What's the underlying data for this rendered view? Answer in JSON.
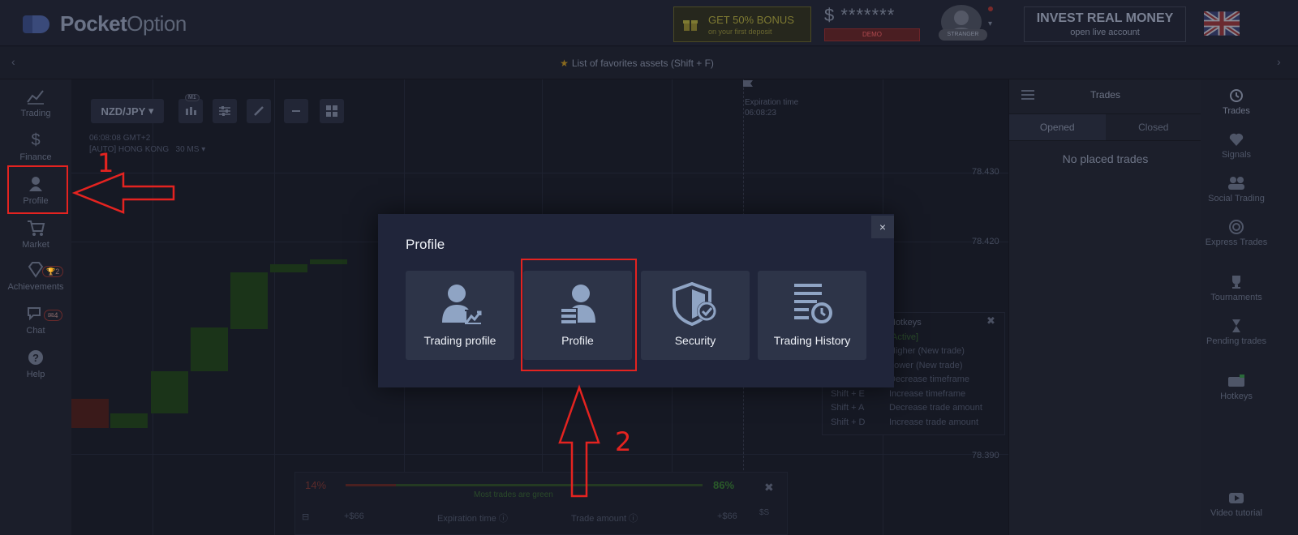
{
  "header": {
    "logo_bold": "Pocket",
    "logo_light": "Option",
    "bonus_title": "GET 50% BONUS",
    "bonus_sub": "on your first deposit",
    "balance": "$ *******",
    "account_type": "DEMO",
    "user_badge": "STRANGER",
    "invest_title": "INVEST REAL MONEY",
    "invest_sub": "open live account",
    "language_flag": "uk-flag-icon"
  },
  "favorites_bar": {
    "text": "List of favorites assets (Shift + F)"
  },
  "left_nav": {
    "items": [
      {
        "label": "Trading",
        "icon": "chart-line-icon"
      },
      {
        "label": "Finance",
        "icon": "dollar-icon"
      },
      {
        "label": "Profile",
        "icon": "user-icon"
      },
      {
        "label": "Market",
        "icon": "cart-icon"
      },
      {
        "label": "Achievements",
        "icon": "diamond-icon",
        "badge": "2"
      },
      {
        "label": "Chat",
        "icon": "chat-icon",
        "badge": "4"
      },
      {
        "label": "Help",
        "icon": "help-icon"
      }
    ]
  },
  "chart": {
    "pair": "NZD/JPY",
    "timeframe_badge": "M1",
    "time": "06:08:08 GMT+2",
    "session": "[AUTO] HONG KONG",
    "period": "30 MS",
    "expiration_label": "Expiration time",
    "expiration_time": "06:08:23",
    "price_ticks": [
      "78.430",
      "78.420",
      "78.390"
    ],
    "hotkeys_title": "Hotkeys",
    "hotkeys_status": "[Active]",
    "hotkeys": [
      {
        "key": "",
        "action": "Higher (New trade)"
      },
      {
        "key": "",
        "action": "Lower (New trade)"
      },
      {
        "key": "",
        "action": "Decrease timeframe"
      },
      {
        "key": "Shift + E",
        "action": "Increase timeframe"
      },
      {
        "key": "Shift + A",
        "action": "Decrease trade amount"
      },
      {
        "key": "Shift + D",
        "action": "Increase trade amount"
      }
    ],
    "sentiment_low": "14%",
    "sentiment_high": "86%",
    "sentiment_note": "Most trades are green",
    "sentiment_fraction": 0.86,
    "bottom_row": {
      "left_amount": "+$66",
      "expiration_label": "Expiration time",
      "trade_amount_label": "Trade amount",
      "right_amount": "+$66",
      "currency": "$S"
    }
  },
  "trades_panel": {
    "title": "Trades",
    "tabs": [
      "Opened",
      "Closed"
    ],
    "empty_text": "No placed trades"
  },
  "right_nav": {
    "items": [
      {
        "label": "Trades",
        "icon": "history-icon"
      },
      {
        "label": "Signals",
        "icon": "signal-icon"
      },
      {
        "label": "Social Trading",
        "icon": "people-icon"
      },
      {
        "label": "Express Trades",
        "icon": "target-icon"
      },
      {
        "label": "Tournaments",
        "icon": "trophy-icon"
      },
      {
        "label": "Pending trades",
        "icon": "hourglass-icon"
      },
      {
        "label": "Hotkeys",
        "icon": "keyboard-icon"
      },
      {
        "label": "Video tutorial",
        "icon": "video-icon"
      }
    ]
  },
  "modal": {
    "title": "Profile",
    "close": "×",
    "tiles": [
      {
        "label": "Trading profile",
        "icon": "trading-profile-icon"
      },
      {
        "label": "Profile",
        "icon": "profile-icon"
      },
      {
        "label": "Security",
        "icon": "shield-check-icon"
      },
      {
        "label": "Trading History",
        "icon": "trading-history-icon"
      }
    ]
  },
  "annotations": {
    "step1": "1",
    "step2": "2",
    "color": "#e42320"
  }
}
